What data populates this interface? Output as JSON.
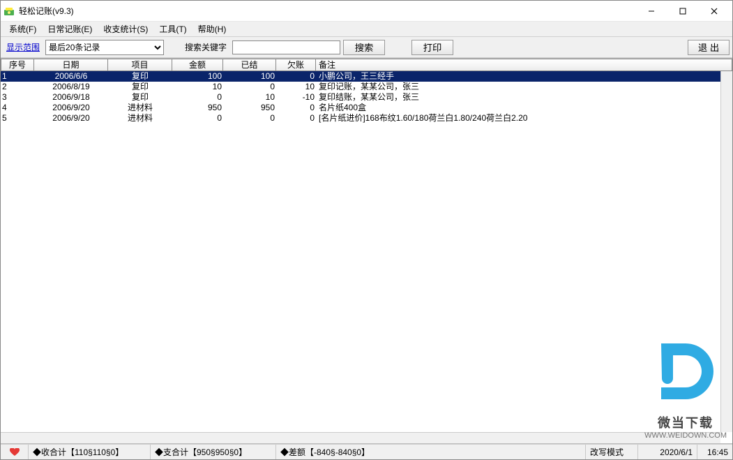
{
  "window": {
    "title": "轻松记账(v9.3)"
  },
  "menu": {
    "system": "系统(F)",
    "daily": "日常记账(E)",
    "stats": "收支统计(S)",
    "tools": "工具(T)",
    "help": "帮助(H)"
  },
  "toolbar": {
    "range_label": "显示范围",
    "range_value": "最后20条记录",
    "search_label": "搜索关键字",
    "search_value": "",
    "search_btn": "搜索",
    "print_btn": "打印",
    "exit_btn": "退 出"
  },
  "columns": {
    "seq": "序号",
    "date": "日期",
    "item": "项目",
    "amount": "金额",
    "paid": "已结",
    "debt": "欠账",
    "remark": "备注"
  },
  "rows": [
    {
      "seq": "1",
      "date": "2006/6/6",
      "item": "复印",
      "amount": "100",
      "paid": "100",
      "debt": "0",
      "remark": "小鹏公司，王三经手",
      "selected": true
    },
    {
      "seq": "2",
      "date": "2006/8/19",
      "item": "复印",
      "amount": "10",
      "paid": "0",
      "debt": "10",
      "remark": "复印记账，某某公司，张三",
      "selected": false
    },
    {
      "seq": "3",
      "date": "2006/9/18",
      "item": "复印",
      "amount": "0",
      "paid": "10",
      "debt": "-10",
      "remark": "复印结账，某某公司，张三",
      "selected": false
    },
    {
      "seq": "4",
      "date": "2006/9/20",
      "item": "进材料",
      "amount": "950",
      "paid": "950",
      "debt": "0",
      "remark": "名片纸400盒",
      "selected": false
    },
    {
      "seq": "5",
      "date": "2006/9/20",
      "item": "进材料",
      "amount": "0",
      "paid": "0",
      "debt": "0",
      "remark": "[名片纸进价]168布纹1.60/180荷兰白1.80/240荷兰白2.20",
      "selected": false
    }
  ],
  "status": {
    "income": "◆收合计【110§110§0】",
    "expense": "◆支合计【950§950§0】",
    "diff": "◆差额【-840§-840§0】",
    "mode": "改写模式",
    "date": "2020/6/1",
    "time": "16:45"
  },
  "watermark": {
    "text": "微当下载",
    "url": "WWW.WEIDOWN.COM"
  },
  "icons": {
    "app": "app-icon",
    "min": "minimize-icon",
    "max": "maximize-icon",
    "close": "close-icon",
    "heart": "heart-icon"
  }
}
